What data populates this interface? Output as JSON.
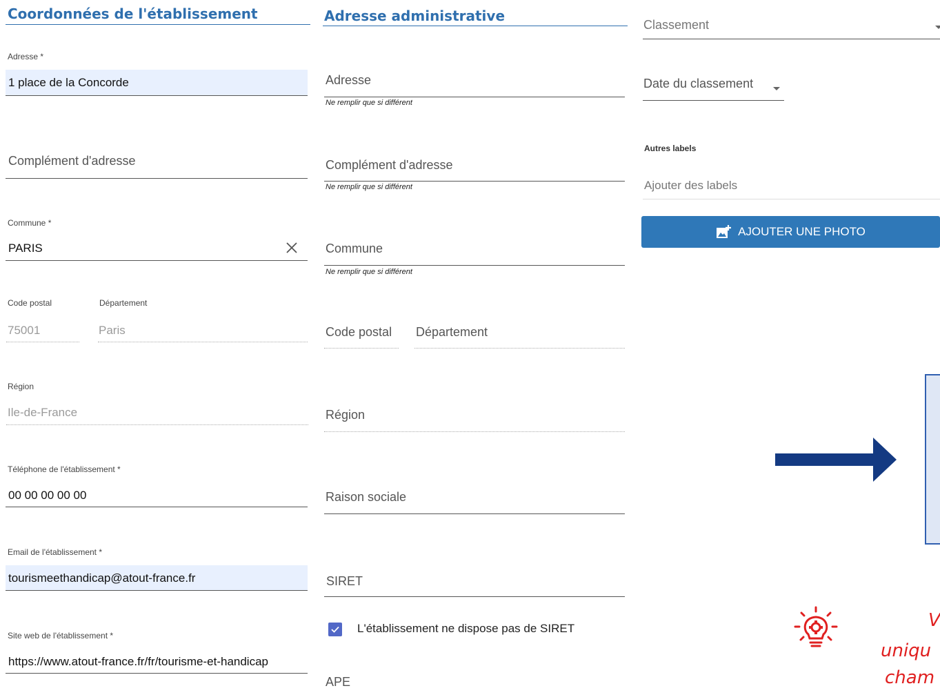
{
  "col1": {
    "title": "Coordonnées de l'établissement",
    "adresse_label": "Adresse *",
    "adresse_value": "1 place de la Concorde",
    "complement_placeholder": "Complément d'adresse",
    "commune_label": "Commune *",
    "commune_value": "PARIS",
    "code_postal_label": "Code postal",
    "code_postal_value": "75001",
    "departement_label": "Département",
    "departement_value": "Paris",
    "region_label": "Région",
    "region_value": "Ile-de-France",
    "telephone_label": "Téléphone de l'établissement *",
    "telephone_value": "00 00 00 00 00",
    "email_label": "Email de l'établissement *",
    "email_value": "tourismeethandicap@atout-france.fr",
    "site_label": "Site web de l'établissement *",
    "site_value": "https://www.atout-france.fr/fr/tourisme-et-handicap"
  },
  "col2": {
    "title": "Adresse administrative",
    "adresse_placeholder": "Adresse",
    "complement_placeholder": "Complément d'adresse",
    "commune_placeholder": "Commune",
    "hint": "Ne remplir que si différent",
    "code_postal_placeholder": "Code postal",
    "departement_placeholder": "Département",
    "region_placeholder": "Région",
    "raison_sociale_placeholder": "Raison sociale",
    "siret_placeholder": "SIRET",
    "no_siret_label": "L'établissement ne dispose pas de SIRET",
    "ape_placeholder": "APE"
  },
  "col3": {
    "classement_placeholder": "Classement",
    "date_classement_placeholder": "Date du classement",
    "autres_labels_label": "Autres labels",
    "autres_labels_placeholder": "Ajouter des labels",
    "add_photo_label": "AJOUTER UNE PHOTO"
  },
  "tip": {
    "line1": "V",
    "line2": "uniqu",
    "line3": "cham"
  },
  "colors": {
    "accent": "#2f6fae",
    "button": "#2f78b8",
    "arrow": "#143a82",
    "tip": "#e02020",
    "checkbox": "#5268c7"
  }
}
